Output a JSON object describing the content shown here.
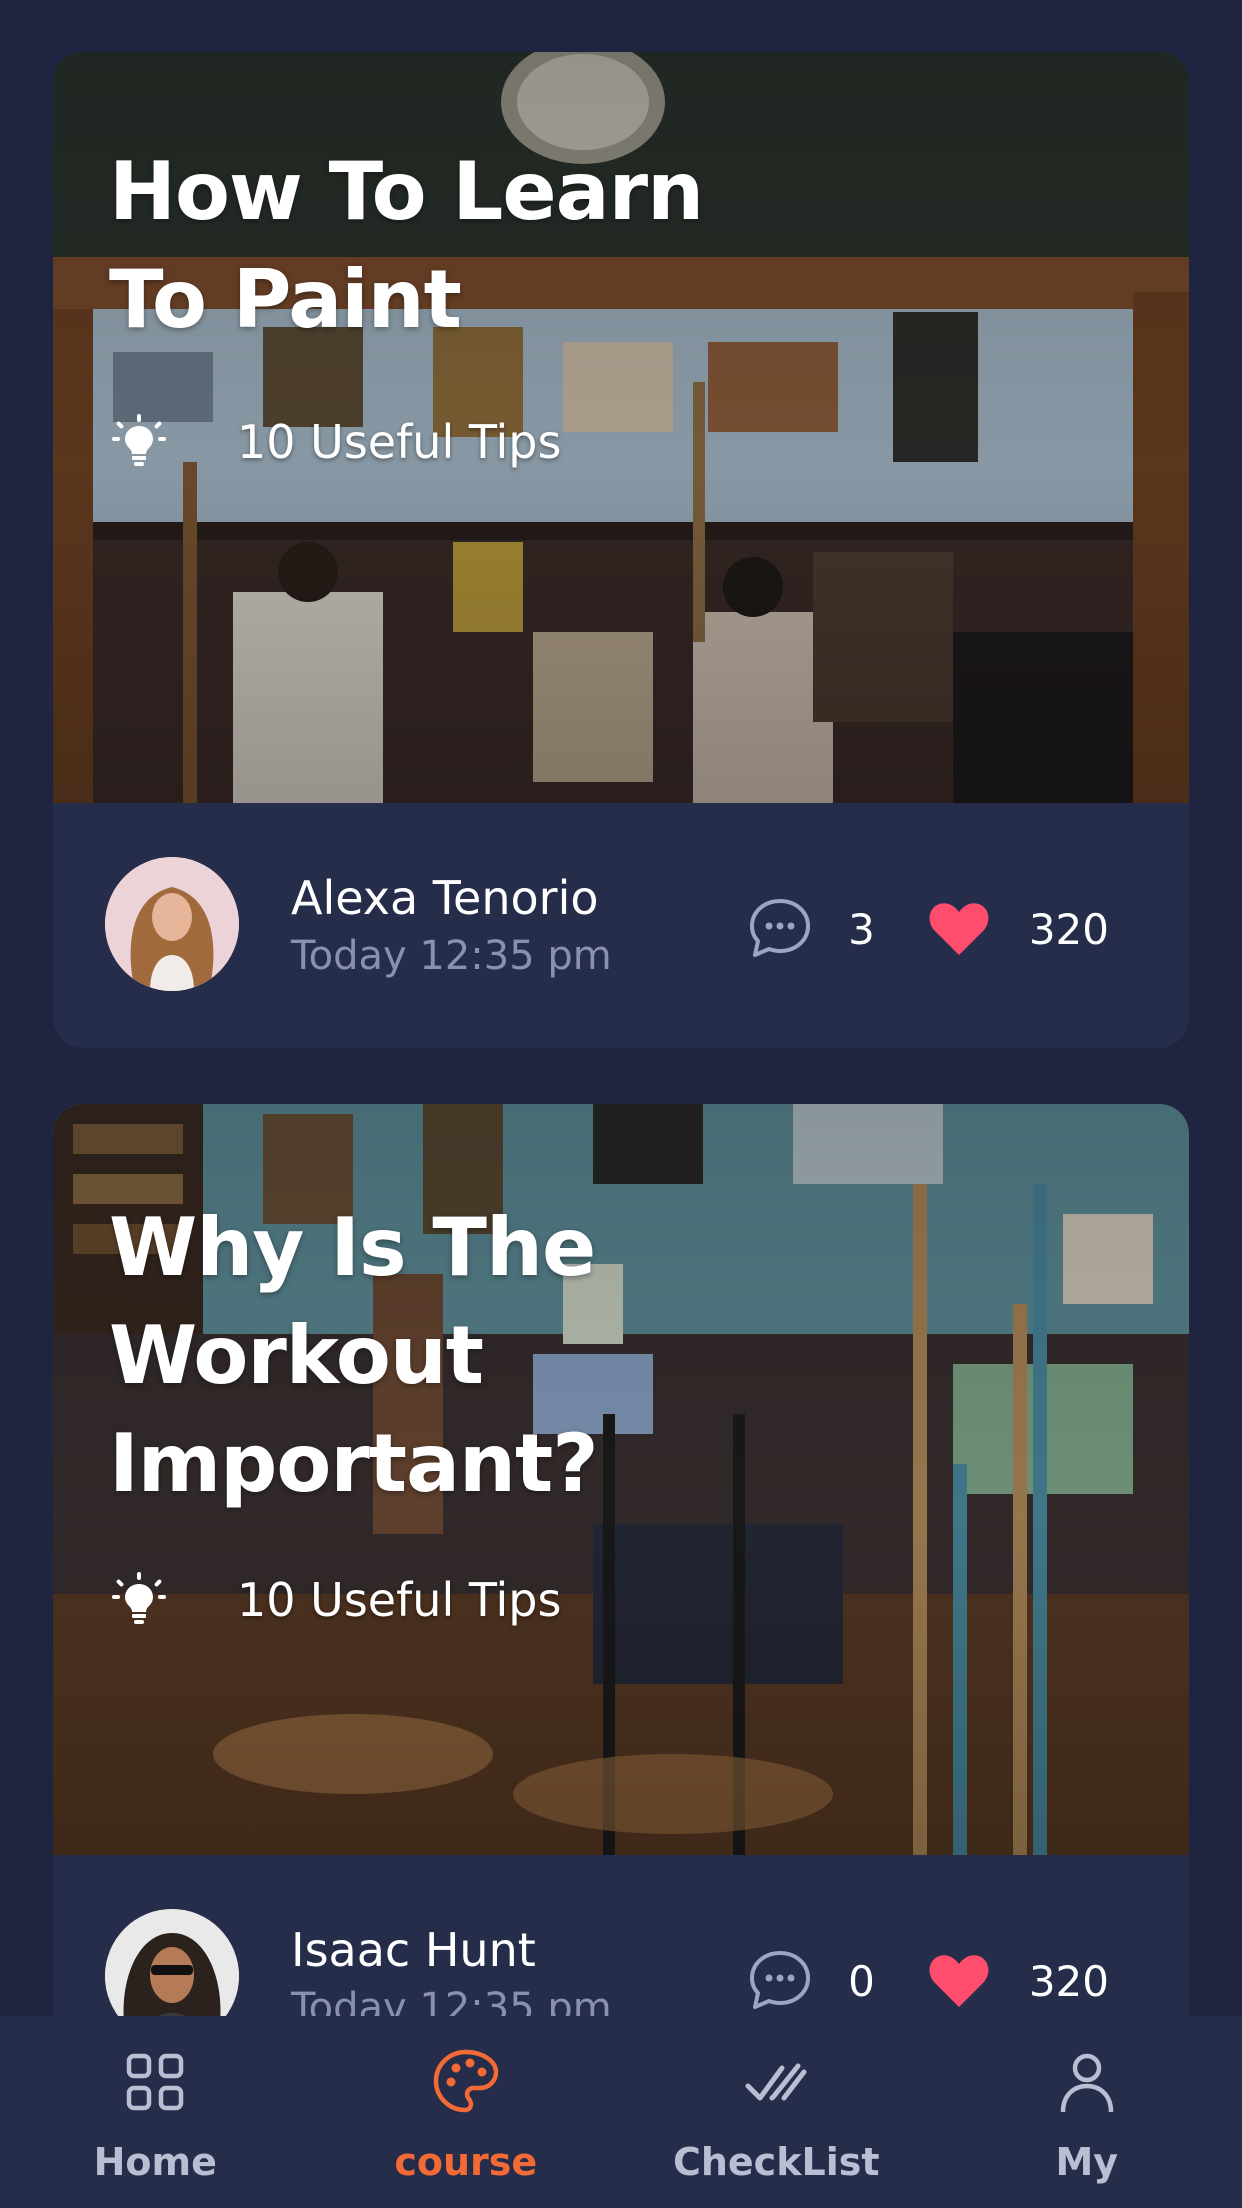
{
  "theme": {
    "background": "#1f2540",
    "card": "#262d4a",
    "accent": "#f26a35",
    "heart": "#ff4d6d",
    "muted_text": "#8a91ad"
  },
  "posts": [
    {
      "title": "How To Learn To Paint",
      "tips_icon": "lightbulb-icon",
      "tips_label": "10 Useful Tips",
      "author": "Alexa Tenorio",
      "time": "Today 12:35 pm",
      "comments_icon": "comment-bubble-icon",
      "comments": "3",
      "likes_icon": "heart-icon",
      "likes": "320"
    },
    {
      "title": "Why Is The Workout Important?",
      "tips_icon": "lightbulb-icon",
      "tips_label": "10 Useful Tips",
      "author": "Isaac Hunt",
      "time": "Today 12:35 pm",
      "comments_icon": "comment-bubble-icon",
      "comments": "0",
      "likes_icon": "heart-icon",
      "likes": "320"
    }
  ],
  "tabbar": {
    "items": [
      {
        "label": "Home",
        "icon": "grid-icon",
        "active": false
      },
      {
        "label": "course",
        "icon": "palette-icon",
        "active": true
      },
      {
        "label": "CheckList",
        "icon": "double-check-icon",
        "active": false
      },
      {
        "label": "My",
        "icon": "user-icon",
        "active": false
      }
    ]
  }
}
